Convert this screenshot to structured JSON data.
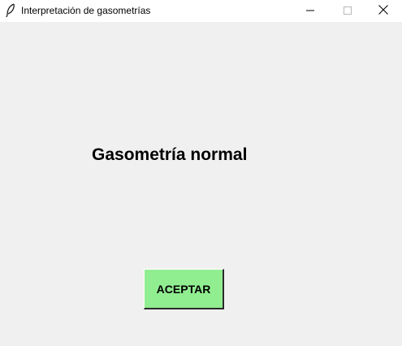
{
  "window": {
    "title": "Interpretación de gasometrías",
    "icon": "feather-icon",
    "controls": {
      "minimize": "minimize-icon",
      "maximize": "maximize-icon",
      "close": "close-icon"
    }
  },
  "main": {
    "result_text": "Gasometría normal",
    "accept_label": "ACEPTAR"
  },
  "colors": {
    "background": "#f0f0f0",
    "titlebar": "#ffffff",
    "accept_button": "#90ee90"
  }
}
